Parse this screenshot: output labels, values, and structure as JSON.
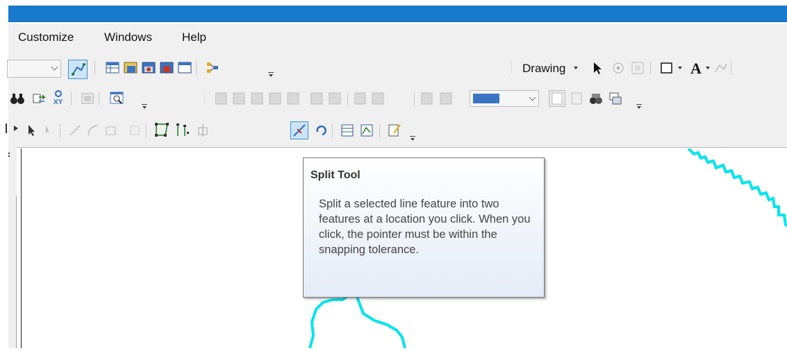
{
  "menu": {
    "items": [
      "Customize",
      "Windows",
      "Help"
    ]
  },
  "drawing_toolbar": {
    "label": "Drawing",
    "text_tool_glyph": "A"
  },
  "tooltip": {
    "title": "Split Tool",
    "body": "Split a selected line feature into two features at a location you click. When you click, the pointer must be within the snapping tolerance."
  },
  "colors": {
    "title_bar": "#1979ca",
    "map_lines": "#00e5ee",
    "toolbar_bg": "#f0f0f0",
    "pressed_tool": "#cce4f7"
  },
  "icons": {
    "row1": [
      "dropdown-arrow-icon",
      "edit-tool-icon",
      "attribute-table-icon",
      "catalog-icon",
      "toolbox-icon",
      "arcmap-red-icon",
      "python-window-icon",
      "model-builder-icon"
    ],
    "row2": [
      "find-binoculars-icon",
      "go-to-xy-icon",
      "xy-icon",
      "identify-icon",
      "zoom-window-icon",
      "spatial-adjustment-icons",
      "layer-combo",
      "layout-icons"
    ],
    "row3": [
      "edit-pointer-icon",
      "edit-annotation-icon",
      "straight-segment-icon",
      "endpoint-arc-icon",
      "trace-icon",
      "rotate-icon",
      "edit-vertices-icon",
      "reshape-icon",
      "cut-polygons-icon",
      "split-tool-icon",
      "rotate-tool-icon",
      "attributes-icon",
      "sketch-properties-icon",
      "editor-options-icon"
    ]
  }
}
